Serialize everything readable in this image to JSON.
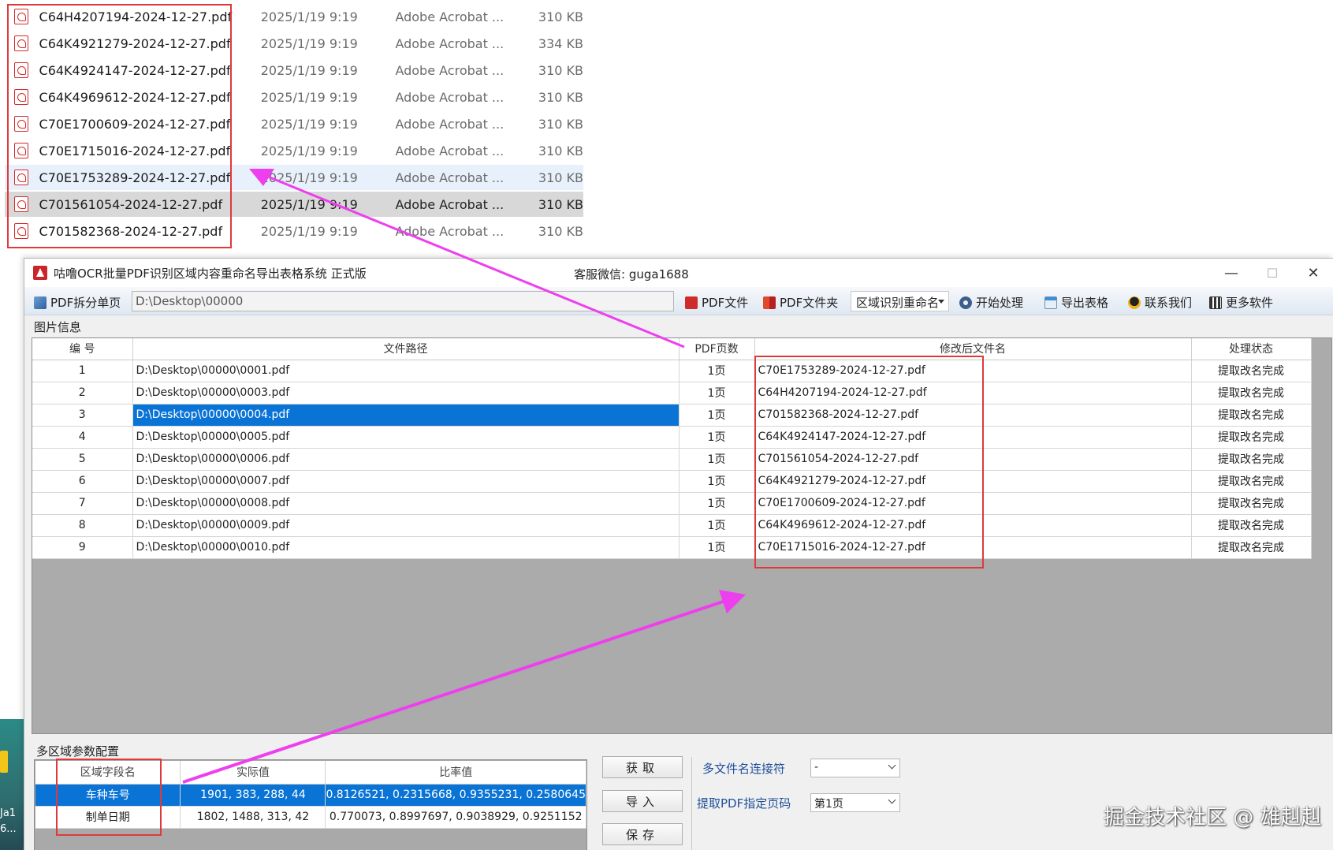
{
  "explorer": {
    "files": [
      {
        "name": "C64H4207194-2024-12-27.pdf",
        "date": "2025/1/19 9:19",
        "type": "Adobe Acrobat ...",
        "size": "310 KB"
      },
      {
        "name": "C64K4921279-2024-12-27.pdf",
        "date": "2025/1/19 9:19",
        "type": "Adobe Acrobat ...",
        "size": "334 KB"
      },
      {
        "name": "C64K4924147-2024-12-27.pdf",
        "date": "2025/1/19 9:19",
        "type": "Adobe Acrobat ...",
        "size": "310 KB"
      },
      {
        "name": "C64K4969612-2024-12-27.pdf",
        "date": "2025/1/19 9:19",
        "type": "Adobe Acrobat ...",
        "size": "310 KB"
      },
      {
        "name": "C70E1700609-2024-12-27.pdf",
        "date": "2025/1/19 9:19",
        "type": "Adobe Acrobat ...",
        "size": "310 KB"
      },
      {
        "name": "C70E1715016-2024-12-27.pdf",
        "date": "2025/1/19 9:19",
        "type": "Adobe Acrobat ...",
        "size": "310 KB"
      },
      {
        "name": "C70E1753289-2024-12-27.pdf",
        "date": "2025/1/19 9:19",
        "type": "Adobe Acrobat ...",
        "size": "310 KB"
      },
      {
        "name": "C701561054-2024-12-27.pdf",
        "date": "2025/1/19 9:19",
        "type": "Adobe Acrobat ...",
        "size": "310 KB"
      },
      {
        "name": "C701582368-2024-12-27.pdf",
        "date": "2025/1/19 9:19",
        "type": "Adobe Acrobat ...",
        "size": "310 KB"
      }
    ]
  },
  "desktop": {
    "label_1": "Ja1",
    "label_2": "6..."
  },
  "window": {
    "title": "咕噜OCR批量PDF识别区域内容重命名导出表格系统  正式版",
    "service": "客服微信: guga1688",
    "min_glyph": "—",
    "max_glyph": "☐",
    "close_glyph": "✕"
  },
  "toolbar": {
    "split_label": "PDF拆分单页",
    "path_value": "D:\\Desktop\\00000",
    "pdf_file_label": "PDF文件",
    "pdf_folder_label": "PDF文件夹",
    "mode_value": "区域识别重命名",
    "start_label": "开始处理",
    "export_label": "导出表格",
    "contact_label": "联系我们",
    "more_label": "更多软件"
  },
  "image_info": {
    "section_label": "图片信息",
    "columns": [
      "编 号",
      "文件路径",
      "PDF页数",
      "修改后文件名",
      "处理状态"
    ],
    "rows": [
      {
        "no": "1",
        "path": "D:\\Desktop\\00000\\0001.pdf",
        "pages": "1页",
        "new_name": "C70E1753289-2024-12-27.pdf",
        "status": "提取改名完成"
      },
      {
        "no": "2",
        "path": "D:\\Desktop\\00000\\0003.pdf",
        "pages": "1页",
        "new_name": "C64H4207194-2024-12-27.pdf",
        "status": "提取改名完成"
      },
      {
        "no": "3",
        "path": "D:\\Desktop\\00000\\0004.pdf",
        "pages": "1页",
        "new_name": "C701582368-2024-12-27.pdf",
        "status": "提取改名完成"
      },
      {
        "no": "4",
        "path": "D:\\Desktop\\00000\\0005.pdf",
        "pages": "1页",
        "new_name": "C64K4924147-2024-12-27.pdf",
        "status": "提取改名完成"
      },
      {
        "no": "5",
        "path": "D:\\Desktop\\00000\\0006.pdf",
        "pages": "1页",
        "new_name": "C701561054-2024-12-27.pdf",
        "status": "提取改名完成"
      },
      {
        "no": "6",
        "path": "D:\\Desktop\\00000\\0007.pdf",
        "pages": "1页",
        "new_name": "C64K4921279-2024-12-27.pdf",
        "status": "提取改名完成"
      },
      {
        "no": "7",
        "path": "D:\\Desktop\\00000\\0008.pdf",
        "pages": "1页",
        "new_name": "C70E1700609-2024-12-27.pdf",
        "status": "提取改名完成"
      },
      {
        "no": "8",
        "path": "D:\\Desktop\\00000\\0009.pdf",
        "pages": "1页",
        "new_name": "C64K4969612-2024-12-27.pdf",
        "status": "提取改名完成"
      },
      {
        "no": "9",
        "path": "D:\\Desktop\\00000\\0010.pdf",
        "pages": "1页",
        "new_name": "C70E1715016-2024-12-27.pdf",
        "status": "提取改名完成"
      }
    ]
  },
  "params": {
    "section_label": "多区域参数配置",
    "columns": [
      "区域字段名",
      "实际值",
      "比率值"
    ],
    "rows": [
      {
        "field": "车种车号",
        "actual": "1901, 383, 288, 44",
        "ratio": "0.8126521, 0.2315668, 0.9355231, 0.2580645"
      },
      {
        "field": "制单日期",
        "actual": "1802, 1488, 313, 42",
        "ratio": "0.770073, 0.8997697, 0.9038929, 0.9251152"
      }
    ],
    "get_label": "获取",
    "import_label": "导入",
    "save_label": "保存",
    "connector_label": "多文件名连接符",
    "connector_value": "-",
    "page_label": "提取PDF指定页码",
    "page_value": "第1页"
  },
  "watermark": "掘金技术社区 @ 雄赳赳",
  "colors": {
    "selection": "#0a74d6",
    "highlight_box": "#e0393c",
    "arrow": "#ee3fee"
  }
}
